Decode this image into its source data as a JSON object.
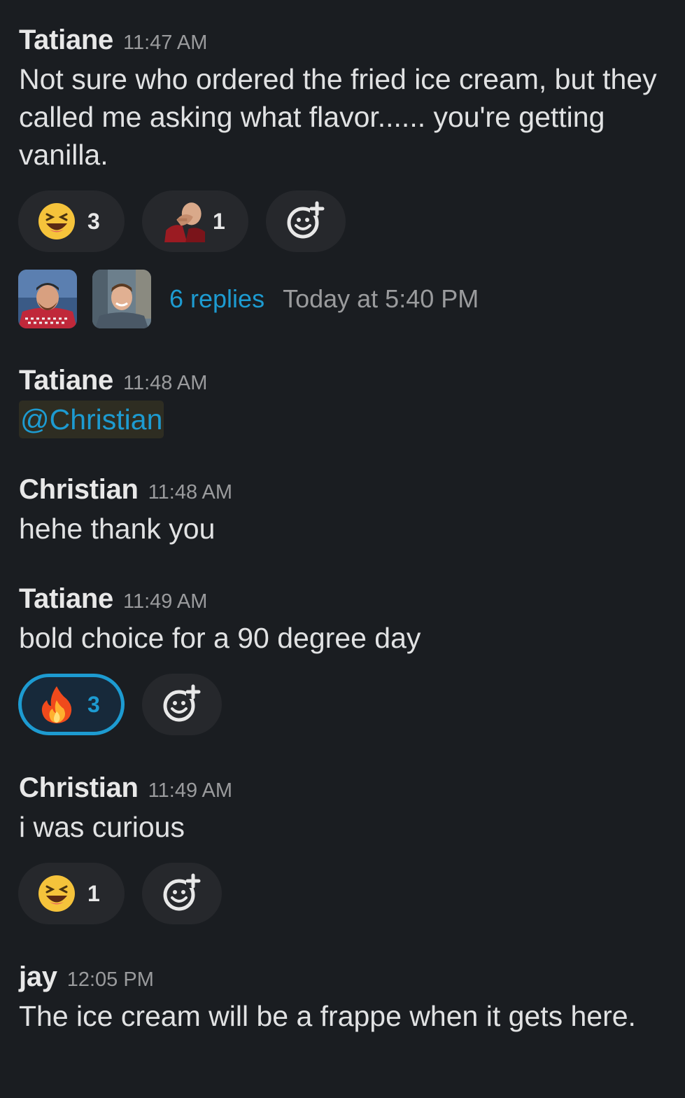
{
  "messages": [
    {
      "name": "Tatiane",
      "time": "11:47 AM",
      "text": "Not sure who ordered the fried ice cream, but they called me asking what flavor...... you're getting vanilla."
    },
    {
      "name": "Tatiane",
      "time": "11:48 AM",
      "mention": "@Christian"
    },
    {
      "name": "Christian",
      "time": "11:48 AM",
      "text": "hehe thank you"
    },
    {
      "name": "Tatiane",
      "time": "11:49 AM",
      "text": "bold choice for a 90 degree day"
    },
    {
      "name": "Christian",
      "time": "11:49 AM",
      "text": "i was curious"
    },
    {
      "name": "jay",
      "time": "12:05 PM",
      "text": "The ice cream will be a frappe when it gets here."
    }
  ],
  "reactions": {
    "msg1": [
      {
        "emoji": "laughing-face-icon",
        "count": "3"
      },
      {
        "emoji": "facepalm-picard-icon",
        "count": "1"
      }
    ],
    "msg4": [
      {
        "emoji": "fire-icon",
        "count": "3",
        "selected": true
      }
    ],
    "msg5": [
      {
        "emoji": "laughing-face-icon",
        "count": "1"
      }
    ]
  },
  "thread": {
    "replies": "6 replies",
    "last_reply": "Today at 5:40 PM"
  },
  "colors": {
    "background": "#1a1d21",
    "link": "#1d9bd1",
    "pill": "#26282c",
    "selected_pill": "#17293a"
  }
}
